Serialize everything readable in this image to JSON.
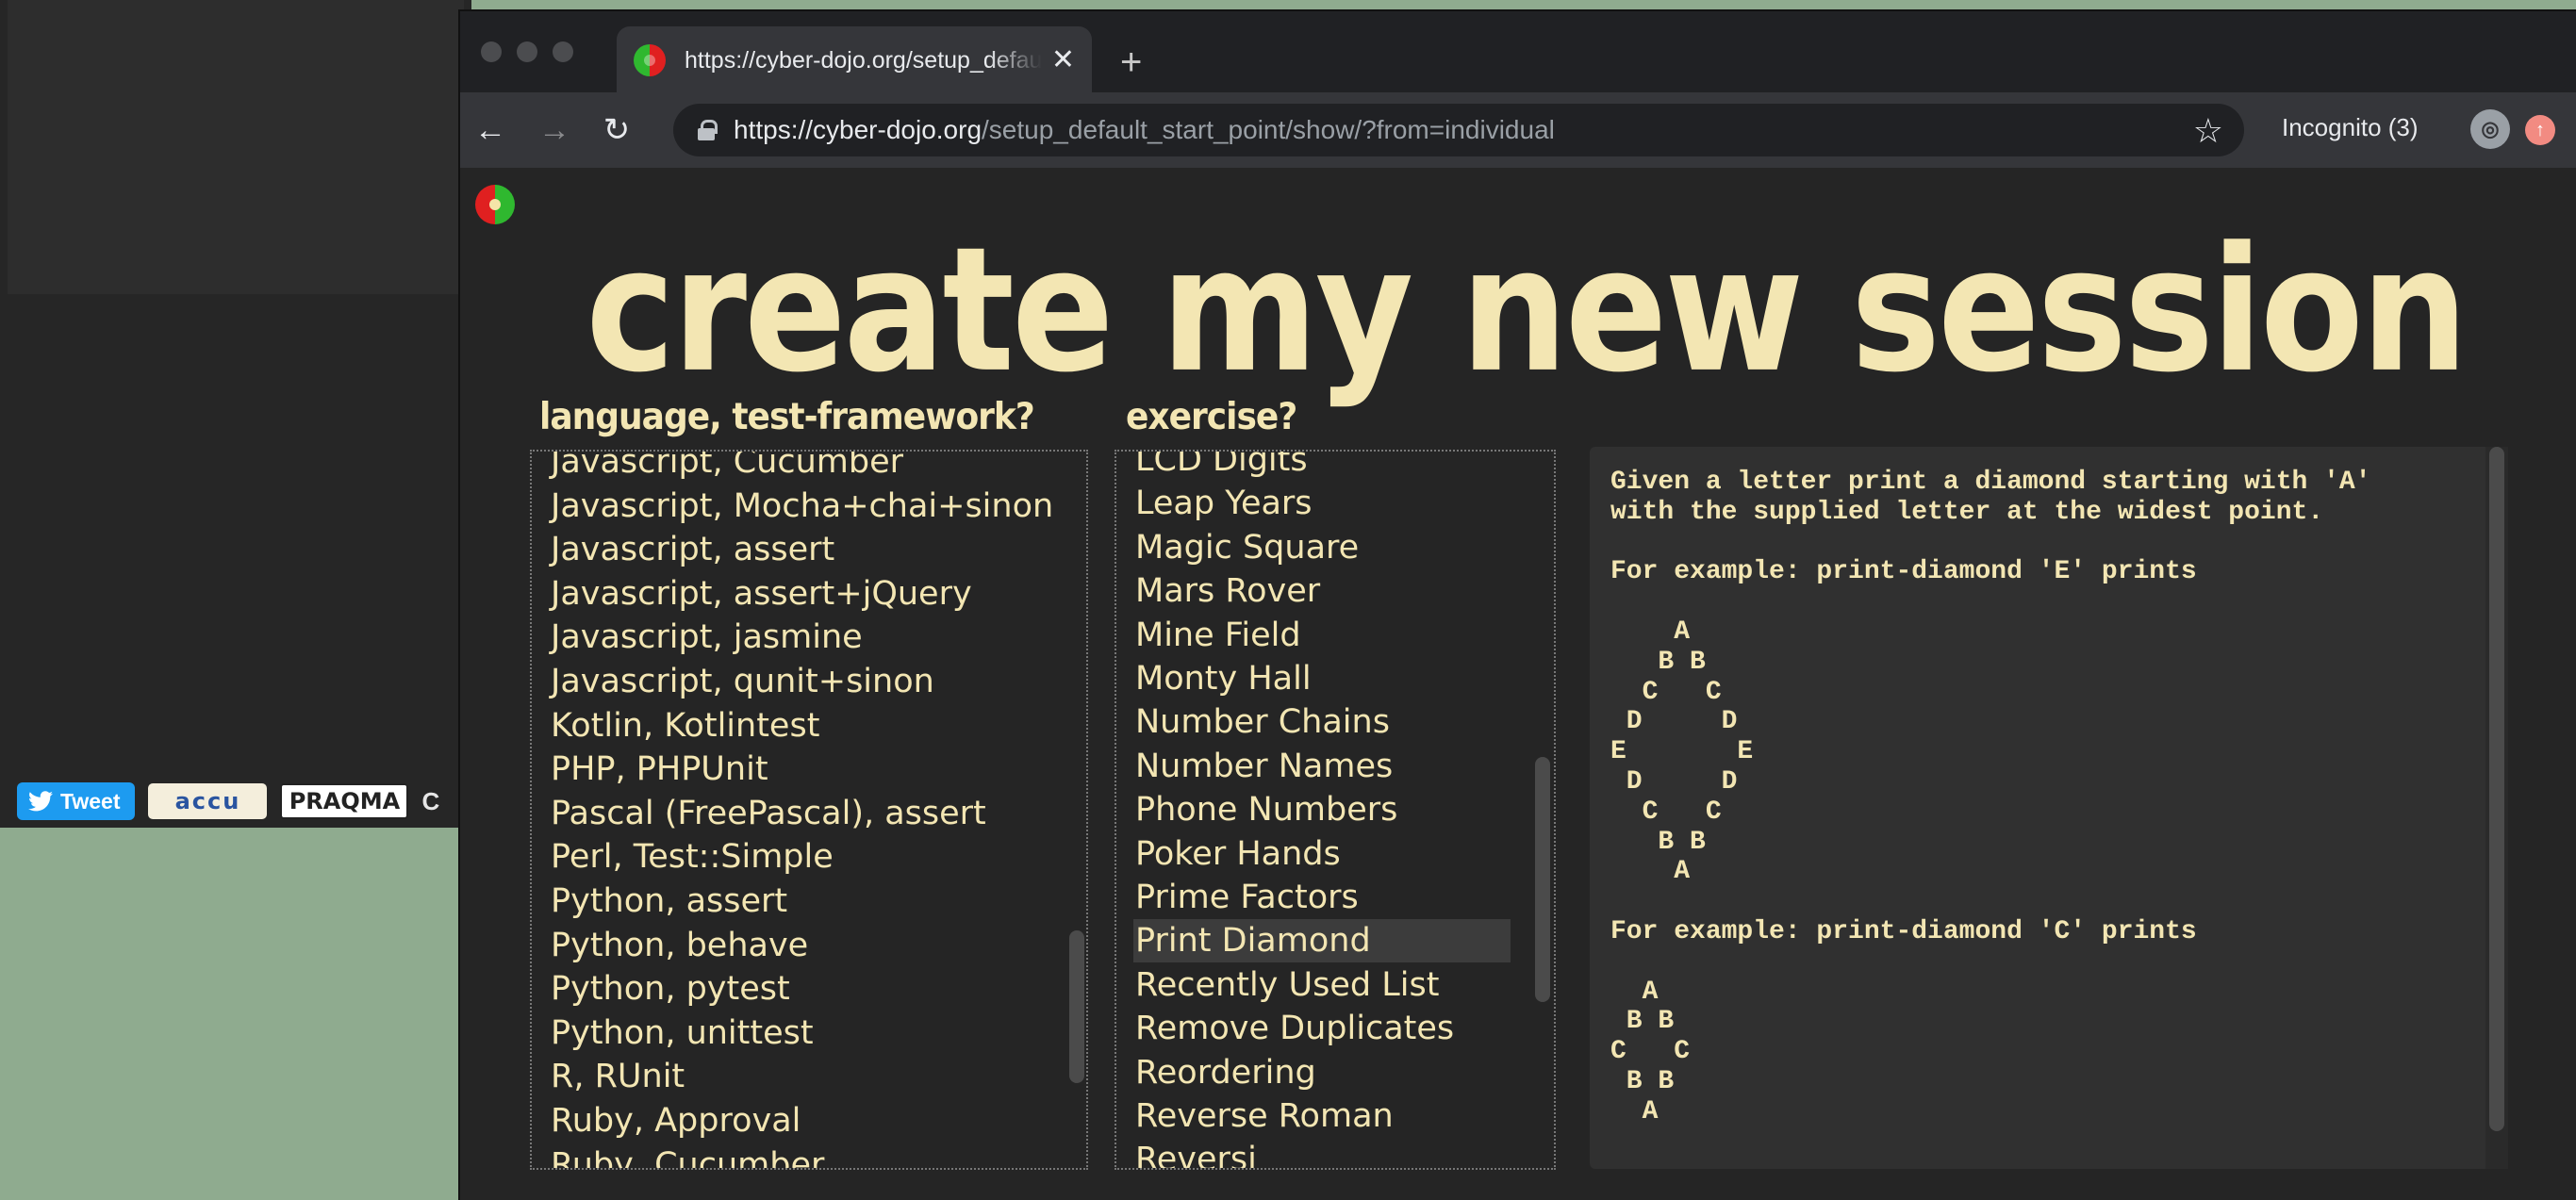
{
  "background_window": {
    "tweet_label": "Tweet",
    "accu_logo": "accu",
    "praqma_logo": "PRAQMA",
    "trailing_text": "C"
  },
  "browser": {
    "tab_title": "https://cyber-dojo.org/setup_default_start_point/show/?from=individual",
    "new_tab": "+",
    "url_host": "https://cyber-dojo.org",
    "url_path": "/setup_default_start_point/show/?from=individual",
    "incognito_label": "Incognito (3)",
    "icons": {
      "back": "arrow-left",
      "forward": "arrow-right",
      "reload": "reload",
      "star": "star",
      "close": "close"
    }
  },
  "page": {
    "heading": "create my new session",
    "language_label": "language, test-framework?",
    "exercise_label": "exercise?",
    "languages": [
      "Javascript, Cucumber",
      "Javascript, Mocha+chai+sinon",
      "Javascript, assert",
      "Javascript, assert+jQuery",
      "Javascript, jasmine",
      "Javascript, qunit+sinon",
      "Kotlin, Kotlintest",
      "PHP, PHPUnit",
      "Pascal (FreePascal), assert",
      "Perl, Test::Simple",
      "Python, assert",
      "Python, behave",
      "Python, pytest",
      "Python, unittest",
      "R, RUnit",
      "Ruby, Approval",
      "Ruby, Cucumber"
    ],
    "exercises": [
      "LCD Digits",
      "Leap Years",
      "Magic Square",
      "Mars Rover",
      "Mine Field",
      "Monty Hall",
      "Number Chains",
      "Number Names",
      "Phone Numbers",
      "Poker Hands",
      "Prime Factors",
      "Print Diamond",
      "Recently Used List",
      "Remove Duplicates",
      "Reordering",
      "Reverse Roman",
      "Reversi"
    ],
    "selected_exercise": "Print Diamond",
    "description": "Given a letter print a diamond starting with 'A'\nwith the supplied letter at the widest point.\n\nFor example: print-diamond 'E' prints\n\n    A\n   B B\n  C   C\n D     D\nE       E\n D     D\n  C   C\n   B B\n    A\n\nFor example: print-diamond 'C' prints\n\n  A\n B B\nC   C\n B B\n  A"
  }
}
